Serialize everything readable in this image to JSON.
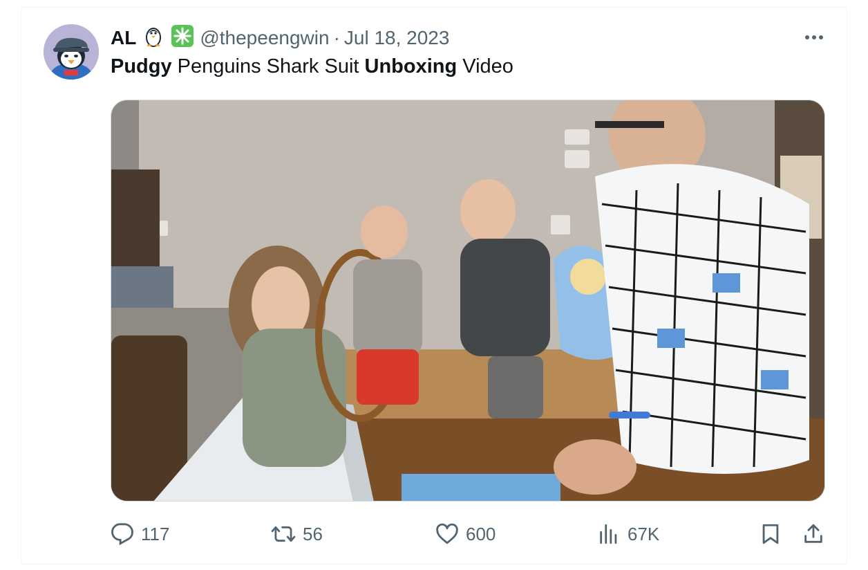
{
  "author": {
    "name": "AL",
    "handle": "@thepeengwin",
    "separator": "·",
    "date": "Jul 18, 2023",
    "emoji_icons": [
      "penguin-icon",
      "sparkle-icon"
    ]
  },
  "tweet": {
    "parts": [
      {
        "text": "Pudgy",
        "bold": true
      },
      {
        "text": " Penguins Shark Suit ",
        "bold": false
      },
      {
        "text": "Unboxing",
        "bold": true
      },
      {
        "text": " Video",
        "bold": false
      }
    ]
  },
  "media": {
    "type": "video-thumbnail"
  },
  "actions": {
    "replies": "117",
    "retweets": "56",
    "likes": "600",
    "views": "67K"
  },
  "colors": {
    "text": "#0f1419",
    "secondary": "#536471",
    "border": "#eff3f4",
    "sparkle": "#59c35a"
  }
}
